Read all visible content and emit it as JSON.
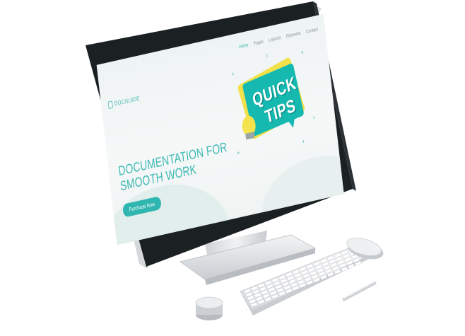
{
  "site": {
    "logo": "DOCGUIDE",
    "nav": [
      {
        "label": "Home",
        "active": true
      },
      {
        "label": "Pages",
        "active": false
      },
      {
        "label": "Layouts",
        "active": false
      },
      {
        "label": "Elements",
        "active": false
      },
      {
        "label": "Contact",
        "active": false
      }
    ]
  },
  "hero": {
    "headline_line1": "DOCUMENTATION FOR",
    "headline_line2": "SMOOTH WORK",
    "cta_label": "Purchase Now"
  },
  "illustration": {
    "word1": "QUICK",
    "word2": "TIPS"
  },
  "colors": {
    "accent": "#2fb6b0",
    "yellow": "#f2e14a",
    "monitor_bezel": "#1c2124",
    "device_silver": "#e4e6e8"
  },
  "icons": [
    "document-logo-icon",
    "lightbulb-icon"
  ]
}
